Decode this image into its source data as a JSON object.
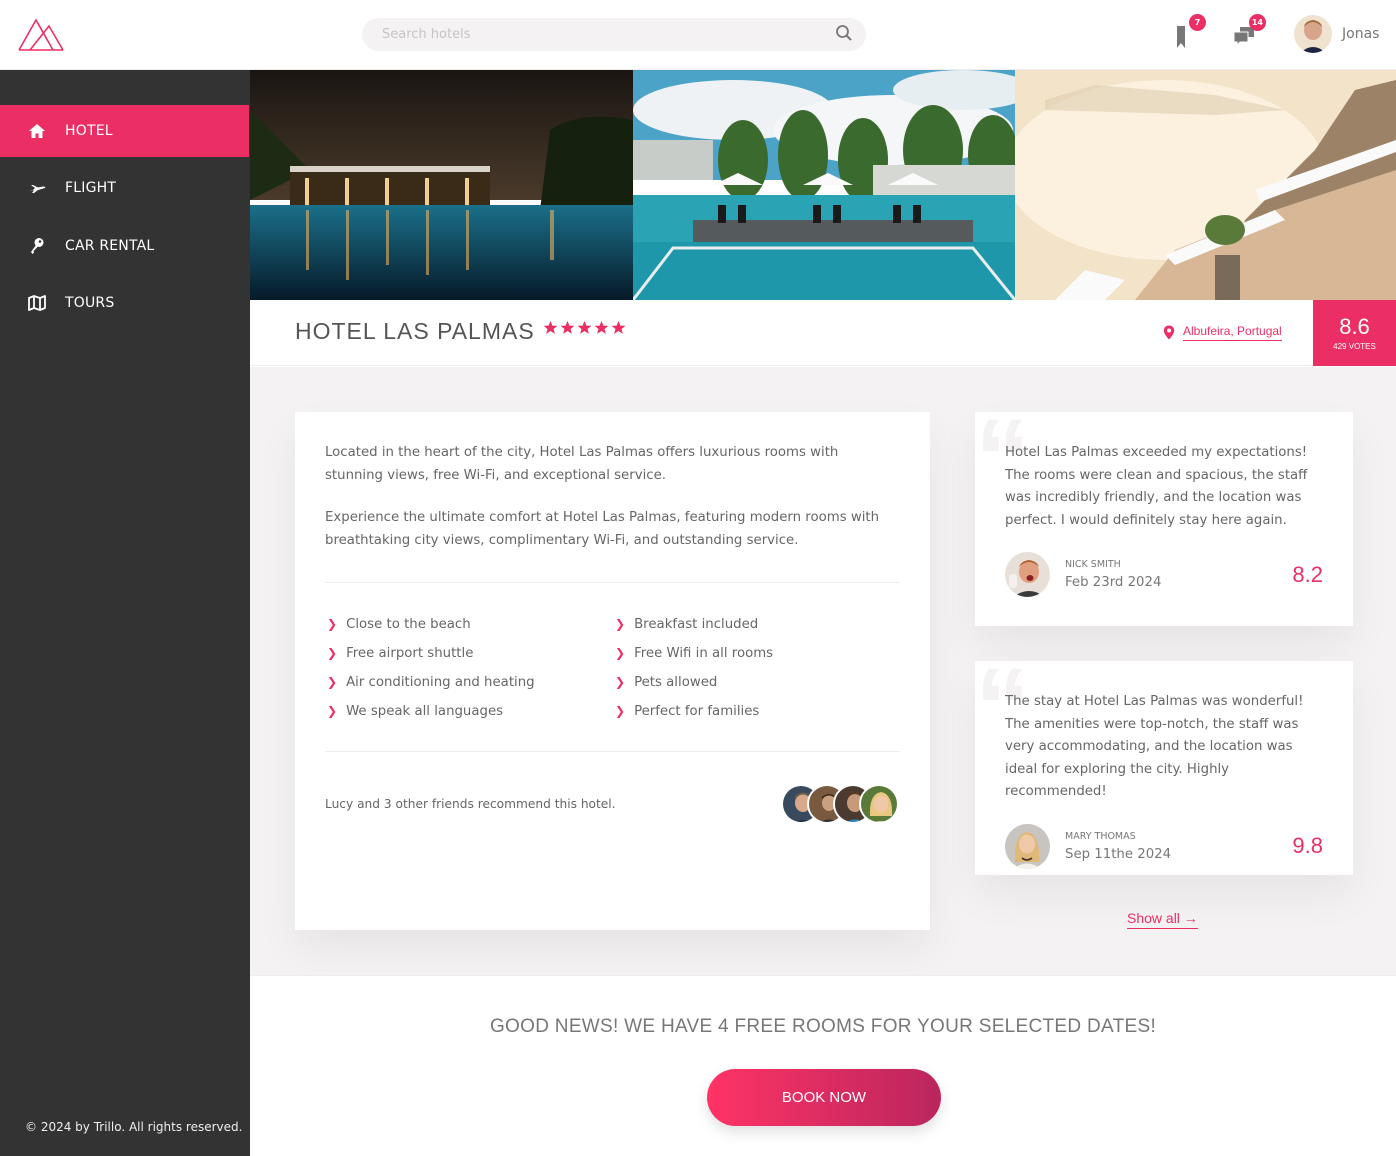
{
  "colors": {
    "accent": "#eb2f64",
    "sidebar": "#333333",
    "background": "#f4f2f2"
  },
  "header": {
    "logo": "trillo-mountain-logo",
    "search": {
      "placeholder": "Search hotels",
      "value": "",
      "icon": "search-icon"
    },
    "bookmarks": {
      "icon": "bookmark-icon",
      "count": "7"
    },
    "messages": {
      "icon": "chat-icon",
      "count": "14"
    },
    "user": {
      "name": "Jonas",
      "icon": "user-avatar"
    }
  },
  "sidebar": {
    "items": [
      {
        "label": "HOTEL",
        "icon": "home-icon",
        "active": true
      },
      {
        "label": "FLIGHT",
        "icon": "airplane-icon",
        "active": false
      },
      {
        "label": "CAR RENTAL",
        "icon": "key-icon",
        "active": false
      },
      {
        "label": "TOURS",
        "icon": "map-icon",
        "active": false
      }
    ],
    "copyright": "© 2024 by Trillo. All rights reserved."
  },
  "gallery": {
    "photos": [
      {
        "alt": "Hotel pool at night"
      },
      {
        "alt": "Hotel pool with umbrellas"
      },
      {
        "alt": "Terrace overlooking sea"
      }
    ]
  },
  "overview": {
    "title": "HOTEL LAS PALMAS",
    "stars": 5,
    "location": "Albufeira, Portugal",
    "rating_average": "8.6",
    "rating_count": "429 VOTES"
  },
  "description": {
    "paragraphs": [
      "Located in the heart of the city, Hotel Las Palmas offers luxurious rooms with stunning views, free Wi-Fi, and exceptional service.",
      "Experience the ultimate comfort at Hotel Las Palmas, featuring modern rooms with breathtaking city views, complimentary Wi-Fi, and outstanding service."
    ],
    "features": [
      "Close to the beach",
      "Breakfast included",
      "Free airport shuttle",
      "Free Wifi in all rooms",
      "Air conditioning and heating",
      "Pets allowed",
      "We speak all languages",
      "Perfect for families"
    ],
    "recommend_text": "Lucy and 3 other friends recommend this hotel.",
    "friends_count": 4
  },
  "reviews": [
    {
      "text": "Hotel Las Palmas exceeded my expectations! The rooms were clean and spacious, the staff was incredibly friendly, and the location was perfect. I would definitely stay here again.",
      "name": "NICK SMITH",
      "date": "Feb 23rd 2024",
      "rating": "8.2"
    },
    {
      "text": "The stay at Hotel Las Palmas was wonderful! The amenities were top-notch, the staff was very accommodating, and the location was ideal for exploring the city. Highly recommended!",
      "name": "MARY THOMAS",
      "date": "Sep 11the 2024",
      "rating": "9.8"
    }
  ],
  "show_all": "Show all →",
  "cta": {
    "text": "GOOD NEWS! WE HAVE 4 FREE ROOMS FOR YOUR SELECTED DATES!",
    "button": "BOOK NOW"
  }
}
